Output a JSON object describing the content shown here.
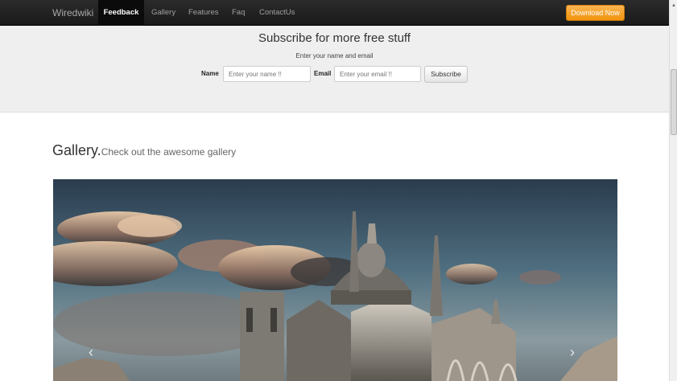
{
  "navbar": {
    "brand": "Wiredwiki",
    "items": [
      {
        "label": "Feedback",
        "active": true
      },
      {
        "label": "Gallery",
        "active": false
      },
      {
        "label": "Features",
        "active": false
      },
      {
        "label": "Faq",
        "active": false
      },
      {
        "label": "ContactUs",
        "active": false
      }
    ],
    "download_label": "Download Now"
  },
  "subscribe": {
    "title": "Subscribe for more free stuff",
    "subtitle": "Enter your name and email",
    "name_label": "Name",
    "name_placeholder": "Enter your name !!",
    "email_label": "Email",
    "email_placeholder": "Enter your email !!",
    "button_label": "Subscribe"
  },
  "gallery": {
    "title": "Gallery.",
    "subtitle": "Check out the awesome gallery",
    "prev_icon": "chevron-left-icon",
    "next_icon": "chevron-right-icon"
  },
  "colors": {
    "navbar_bg": "#1f1f1f",
    "accent": "#f7a22b",
    "hero_bg": "#efefef"
  }
}
